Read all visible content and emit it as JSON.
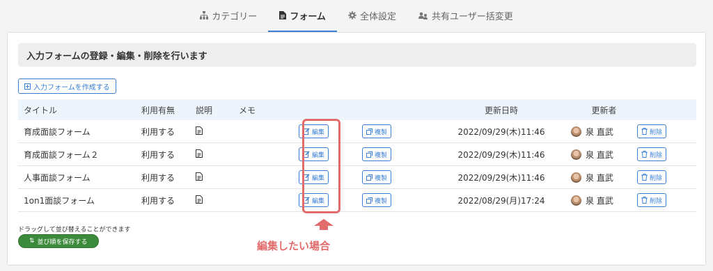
{
  "tabs": [
    {
      "label": "カテゴリー",
      "icon": "sitemap-icon",
      "active": false
    },
    {
      "label": "フォーム",
      "icon": "file-icon",
      "active": true
    },
    {
      "label": "全体設定",
      "icon": "gear-icon",
      "active": false
    },
    {
      "label": "共有ユーザー括変更",
      "icon": "users-icon",
      "active": false
    }
  ],
  "panel": {
    "heading": "入力フォームの登録・編集・削除を行います",
    "create_label": "入力フォームを作成する"
  },
  "table": {
    "headers": {
      "title": "タイトル",
      "usage": "利用有無",
      "desc": "説明",
      "memo": "メモ",
      "date": "更新日時",
      "user": "更新者"
    },
    "edit_label": "編集",
    "copy_label": "複製",
    "delete_label": "削除",
    "rows": [
      {
        "title": "育成面談フォーム",
        "usage": "利用する",
        "date": "2022/09/29(木)11:46",
        "user": "泉 直武"
      },
      {
        "title": "育成面談フォーム２",
        "usage": "利用する",
        "date": "2022/09/29(木)11:46",
        "user": "泉 直武"
      },
      {
        "title": "人事面談フォーム",
        "usage": "利用する",
        "date": "2022/09/29(木)11:46",
        "user": "泉 直武"
      },
      {
        "title": "1on1面談フォーム",
        "usage": "利用する",
        "date": "2022/08/29(月)17:24",
        "user": "泉 直武"
      }
    ]
  },
  "footer": {
    "drag_note": "ドラッグして並び替えることができます",
    "save_label": "並び順を保存する"
  },
  "annotation": {
    "callout": "編集したい場合"
  },
  "colors": {
    "accent": "#3a7fd5",
    "highlight": "#e26c6c",
    "save": "#3c8b3c"
  }
}
